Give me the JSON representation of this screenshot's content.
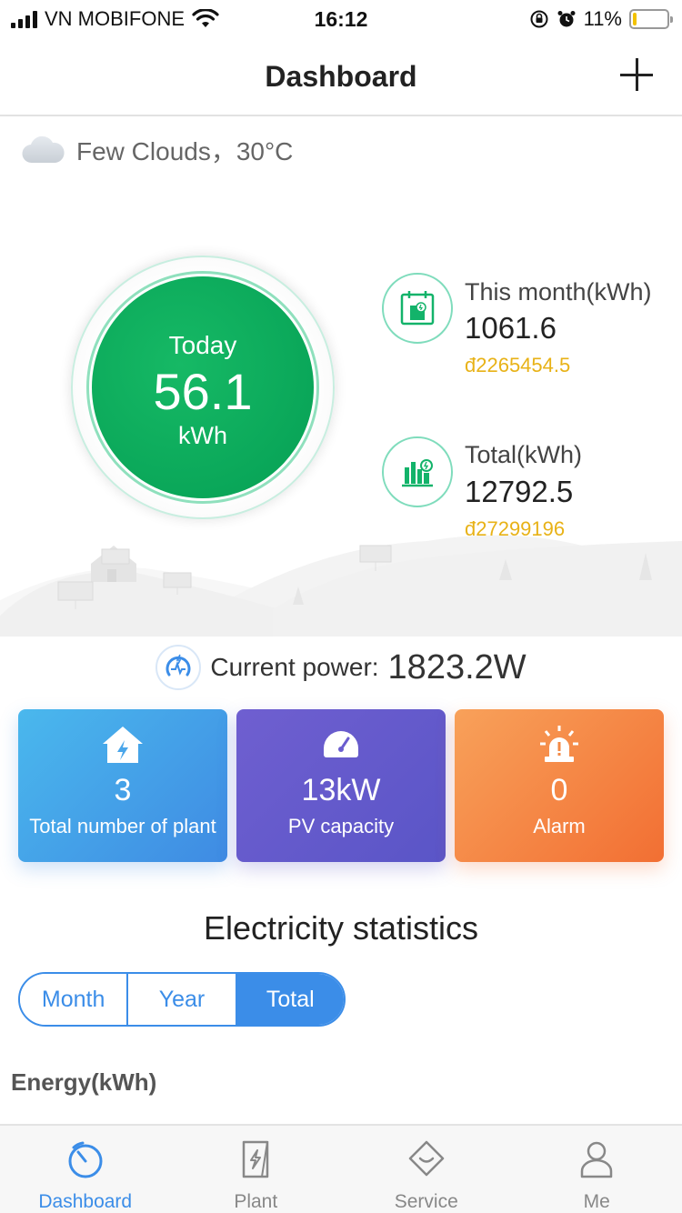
{
  "status_bar": {
    "carrier": "VN MOBIFONE",
    "time": "16:12",
    "battery": "11%",
    "battery_level": 0.11
  },
  "header": {
    "title": "Dashboard",
    "add_icon": "plus-icon"
  },
  "weather": {
    "icon": "cloud-icon",
    "text": "Few Clouds，30°C"
  },
  "today": {
    "label": "Today",
    "value": "56.1",
    "unit": "kWh"
  },
  "this_month": {
    "title": "This month(kWh)",
    "value": "1061.6",
    "money": "đ2265454.5",
    "icon": "calendar-energy-icon"
  },
  "total": {
    "title": "Total(kWh)",
    "value": "12792.5",
    "money": "đ27299196",
    "icon": "bar-chart-energy-icon"
  },
  "current_power": {
    "label": "Current power:",
    "value": "1823.2W",
    "icon": "power-gauge-icon"
  },
  "cards": {
    "plants": {
      "value": "3",
      "label": "Total number of plant",
      "icon": "house-bolt-icon"
    },
    "pv": {
      "value": "13kW",
      "label": "PV capacity",
      "icon": "gauge-icon"
    },
    "alarm": {
      "value": "0",
      "label": "Alarm",
      "icon": "siren-icon"
    }
  },
  "stats": {
    "title": "Electricity statistics",
    "tabs": [
      {
        "label": "Month"
      },
      {
        "label": "Year"
      },
      {
        "label": "Total"
      }
    ],
    "selected": "Total",
    "energy_label": "Energy(kWh)"
  },
  "tab_bar": {
    "items": [
      {
        "label": "Dashboard",
        "icon": "dashboard-icon"
      },
      {
        "label": "Plant",
        "icon": "plant-icon"
      },
      {
        "label": "Service",
        "icon": "service-icon"
      },
      {
        "label": "Me",
        "icon": "user-icon"
      }
    ],
    "active": "Dashboard"
  },
  "colors": {
    "accent": "#3b8de8",
    "green": "#059f54",
    "money": "#e8b217"
  }
}
